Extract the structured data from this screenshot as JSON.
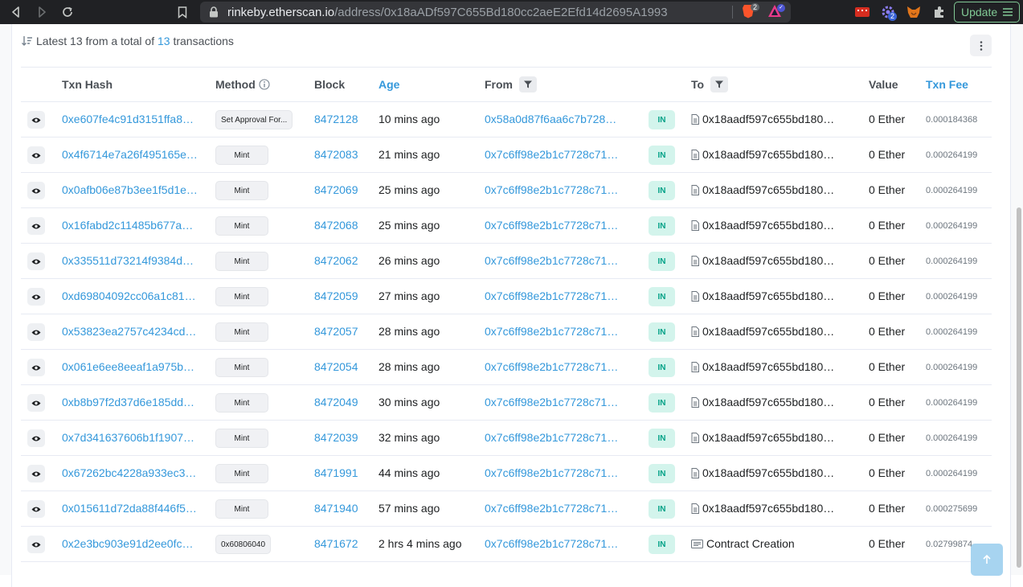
{
  "browser": {
    "url_host": "rinkeby.etherscan.io",
    "url_path": "/address/0x18aADf597C655Bd180cc2aeE2Efd14d2695A1993",
    "update_label": "Update",
    "brave_count": "2",
    "ext_count": "2"
  },
  "summary": {
    "prefix": "Latest 13 from a total of",
    "total": "13",
    "suffix": "transactions"
  },
  "table": {
    "headers": {
      "txn_hash": "Txn Hash",
      "method": "Method",
      "block": "Block",
      "age": "Age",
      "from": "From",
      "to": "To",
      "value": "Value",
      "fee": "Txn Fee"
    },
    "rows": [
      {
        "hash": "0xe607fe4c91d3151ffa8…",
        "method": "Set Approval For...",
        "block": "8472128",
        "age": "10 mins ago",
        "from": "0x58a0d87f6aa6c7b728…",
        "direction": "IN",
        "to": "0x18aadf597c655bd180…",
        "to_type": "contract",
        "value": "0 Ether",
        "fee": "0.000184368"
      },
      {
        "hash": "0x4f6714e7a26f495165e…",
        "method": "Mint",
        "block": "8472083",
        "age": "21 mins ago",
        "from": "0x7c6ff98e2b1c7728c71…",
        "direction": "IN",
        "to": "0x18aadf597c655bd180…",
        "to_type": "contract",
        "value": "0 Ether",
        "fee": "0.000264199"
      },
      {
        "hash": "0x0afb06e87b3ee1f5d1e…",
        "method": "Mint",
        "block": "8472069",
        "age": "25 mins ago",
        "from": "0x7c6ff98e2b1c7728c71…",
        "direction": "IN",
        "to": "0x18aadf597c655bd180…",
        "to_type": "contract",
        "value": "0 Ether",
        "fee": "0.000264199"
      },
      {
        "hash": "0x16fabd2c11485b677a…",
        "method": "Mint",
        "block": "8472068",
        "age": "25 mins ago",
        "from": "0x7c6ff98e2b1c7728c71…",
        "direction": "IN",
        "to": "0x18aadf597c655bd180…",
        "to_type": "contract",
        "value": "0 Ether",
        "fee": "0.000264199"
      },
      {
        "hash": "0x335511d73214f9384d…",
        "method": "Mint",
        "block": "8472062",
        "age": "26 mins ago",
        "from": "0x7c6ff98e2b1c7728c71…",
        "direction": "IN",
        "to": "0x18aadf597c655bd180…",
        "to_type": "contract",
        "value": "0 Ether",
        "fee": "0.000264199"
      },
      {
        "hash": "0xd69804092cc06a1c81…",
        "method": "Mint",
        "block": "8472059",
        "age": "27 mins ago",
        "from": "0x7c6ff98e2b1c7728c71…",
        "direction": "IN",
        "to": "0x18aadf597c655bd180…",
        "to_type": "contract",
        "value": "0 Ether",
        "fee": "0.000264199"
      },
      {
        "hash": "0x53823ea2757c4234cd…",
        "method": "Mint",
        "block": "8472057",
        "age": "28 mins ago",
        "from": "0x7c6ff98e2b1c7728c71…",
        "direction": "IN",
        "to": "0x18aadf597c655bd180…",
        "to_type": "contract",
        "value": "0 Ether",
        "fee": "0.000264199"
      },
      {
        "hash": "0x061e6ee8eeaf1a975b…",
        "method": "Mint",
        "block": "8472054",
        "age": "28 mins ago",
        "from": "0x7c6ff98e2b1c7728c71…",
        "direction": "IN",
        "to": "0x18aadf597c655bd180…",
        "to_type": "contract",
        "value": "0 Ether",
        "fee": "0.000264199"
      },
      {
        "hash": "0xb8b97f2d37d6e185dd…",
        "method": "Mint",
        "block": "8472049",
        "age": "30 mins ago",
        "from": "0x7c6ff98e2b1c7728c71…",
        "direction": "IN",
        "to": "0x18aadf597c655bd180…",
        "to_type": "contract",
        "value": "0 Ether",
        "fee": "0.000264199"
      },
      {
        "hash": "0x7d341637606b1f1907…",
        "method": "Mint",
        "block": "8472039",
        "age": "32 mins ago",
        "from": "0x7c6ff98e2b1c7728c71…",
        "direction": "IN",
        "to": "0x18aadf597c655bd180…",
        "to_type": "contract",
        "value": "0 Ether",
        "fee": "0.000264199"
      },
      {
        "hash": "0x67262bc4228a933ec3…",
        "method": "Mint",
        "block": "8471991",
        "age": "44 mins ago",
        "from": "0x7c6ff98e2b1c7728c71…",
        "direction": "IN",
        "to": "0x18aadf597c655bd180…",
        "to_type": "contract",
        "value": "0 Ether",
        "fee": "0.000264199"
      },
      {
        "hash": "0x015611d72da88f446f5…",
        "method": "Mint",
        "block": "8471940",
        "age": "57 mins ago",
        "from": "0x7c6ff98e2b1c7728c71…",
        "direction": "IN",
        "to": "0x18aadf597c655bd180…",
        "to_type": "contract",
        "value": "0 Ether",
        "fee": "0.000275699"
      },
      {
        "hash": "0x2e3bc903e91d2ee0fc…",
        "method": "0x60806040",
        "block": "8471672",
        "age": "2 hrs 4 mins ago",
        "from": "0x7c6ff98e2b1c7728c71…",
        "direction": "IN",
        "to": "Contract Creation",
        "to_type": "creation",
        "value": "0 Ether",
        "fee": "0.02799874"
      }
    ]
  },
  "colors": {
    "link": "#3498db",
    "in_badge_bg": "#d3f4ec",
    "in_badge_text": "#00a186",
    "chrome_bg": "#202124",
    "update_green": "#81c995"
  },
  "icons": {
    "back": "back-icon",
    "forward": "forward-icon",
    "reload": "reload-icon",
    "bookmark": "bookmark-icon",
    "lock": "lock-icon",
    "eye": "eye-icon",
    "filter": "filter-icon",
    "info": "info-icon",
    "contract": "contract-doc-icon",
    "creation": "contract-creation-icon",
    "sort": "sort-icon",
    "kebab": "kebab-icon",
    "arrow_up": "arrow-up-icon"
  }
}
